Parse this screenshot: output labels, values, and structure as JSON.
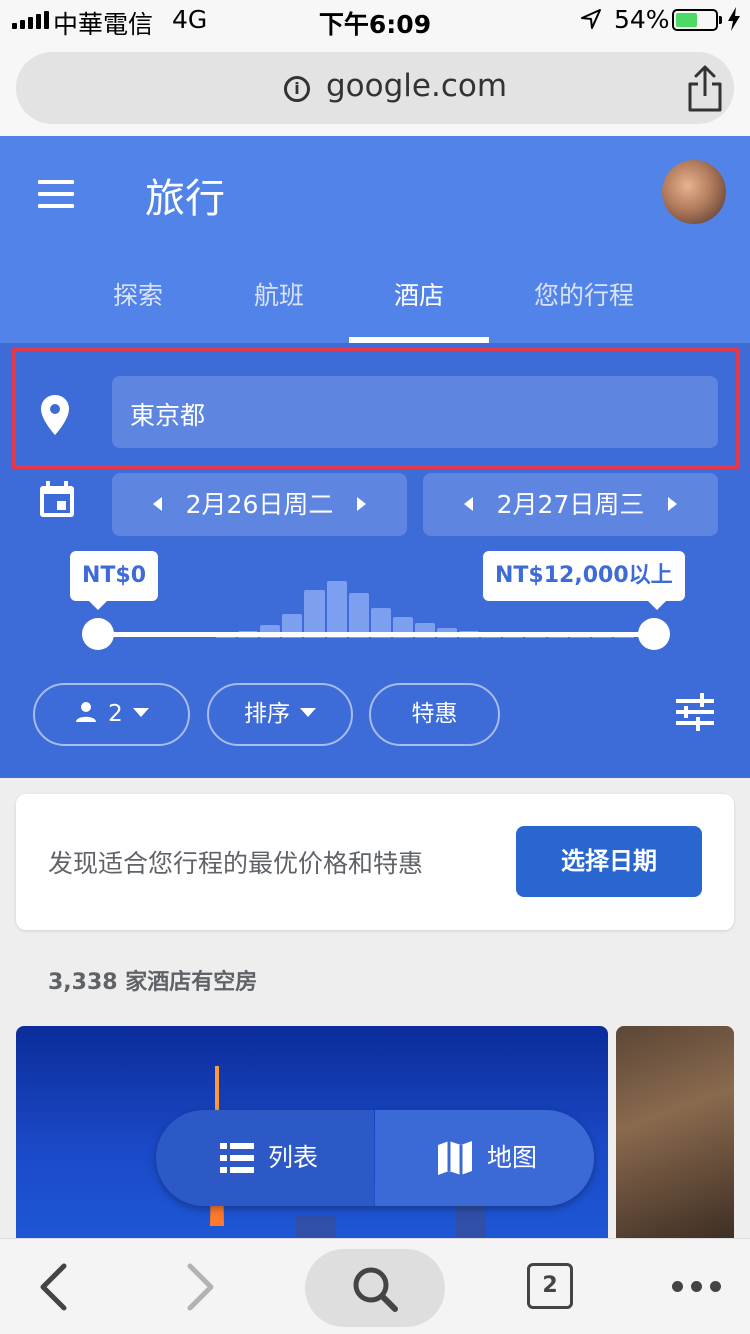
{
  "status_bar": {
    "carrier": "中華電信",
    "network": "4G",
    "time": "下午6:09",
    "battery": "54%",
    "battery_level": 0.54
  },
  "browser": {
    "url": "google.com"
  },
  "header": {
    "title": "旅行",
    "tabs": [
      {
        "label": "探索",
        "active": false
      },
      {
        "label": "航班",
        "active": false
      },
      {
        "label": "酒店",
        "active": true
      },
      {
        "label": "您的行程",
        "active": false
      }
    ]
  },
  "search": {
    "destination": "東京都",
    "check_in": "2月26日周二",
    "check_out": "2月27日周三",
    "price_min": "NT$0",
    "price_max": "NT$12,000以上",
    "histogram": [
      0.05,
      0.12,
      0.22,
      0.4,
      0.8,
      0.95,
      0.75,
      0.5,
      0.35,
      0.25,
      0.16,
      0.12,
      0.1,
      0.1,
      0.08,
      0.08,
      0.06,
      0.05,
      0.1
    ]
  },
  "filters": {
    "guests": "2",
    "sort": "排序",
    "deals": "特惠"
  },
  "promo": {
    "text": "发现适合您行程的最优价格和特惠",
    "button": "选择日期"
  },
  "results": {
    "count_text": "3,338 家酒店有空房"
  },
  "view_toggle": {
    "list": "列表",
    "map": "地图"
  },
  "toolbar": {
    "tabs_count": "2"
  },
  "colors": {
    "header_blue": "#5283e8",
    "panel_blue": "#3d6bd8",
    "highlight_red": "#e4384c",
    "button_blue": "#2a66d0"
  }
}
